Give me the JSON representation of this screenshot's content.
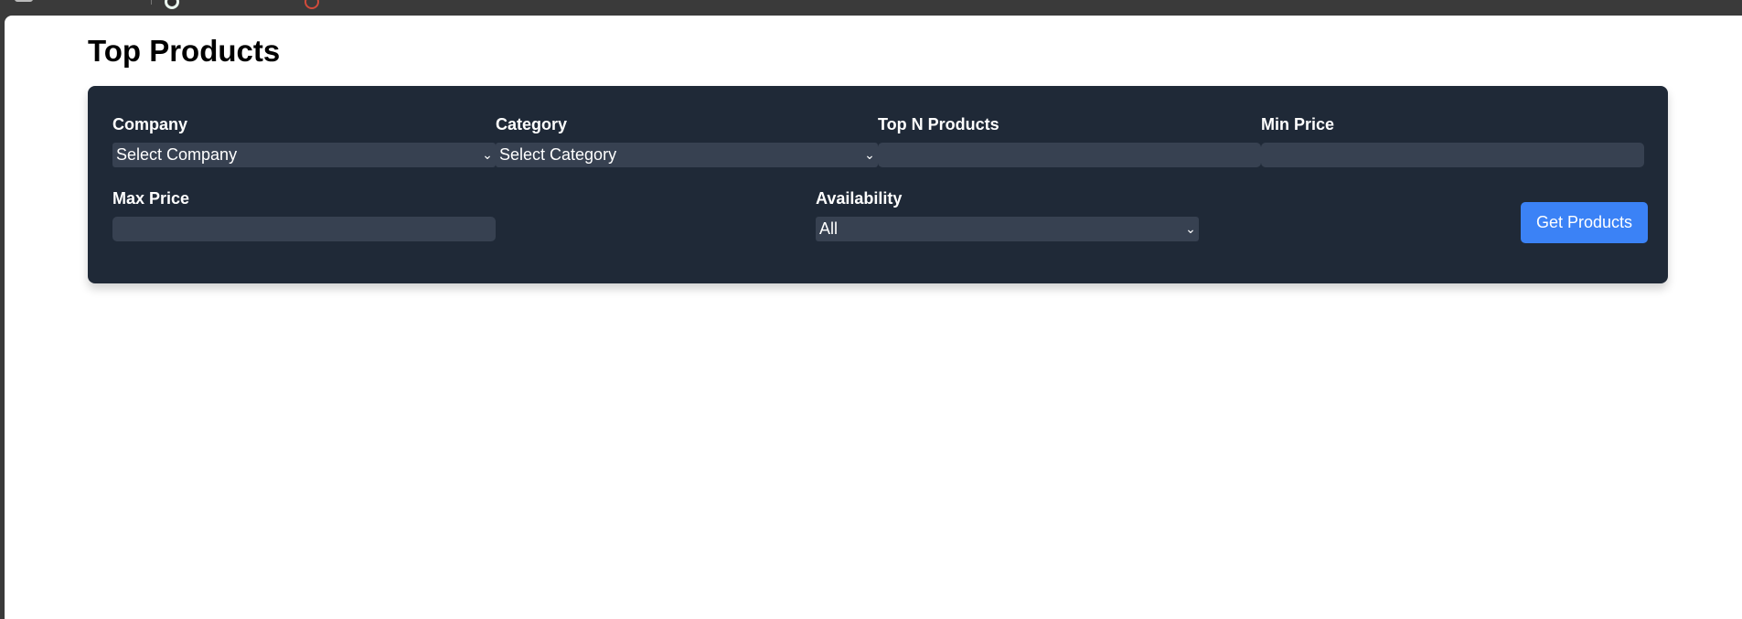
{
  "page": {
    "title": "Top Products"
  },
  "filters": {
    "company": {
      "label": "Company",
      "value": "Select Company"
    },
    "category": {
      "label": "Category",
      "value": "Select Category"
    },
    "top_n": {
      "label": "Top N Products",
      "value": ""
    },
    "min_price": {
      "label": "Min Price",
      "value": ""
    },
    "max_price": {
      "label": "Max Price",
      "value": ""
    },
    "availability": {
      "label": "Availability",
      "value": "All"
    }
  },
  "actions": {
    "get_products_label": "Get Products"
  },
  "colors": {
    "panel_bg": "#1f2937",
    "input_bg": "#374151",
    "accent": "#3b82f6"
  },
  "icons": {
    "select_arrow": "chevron-down-icon"
  }
}
